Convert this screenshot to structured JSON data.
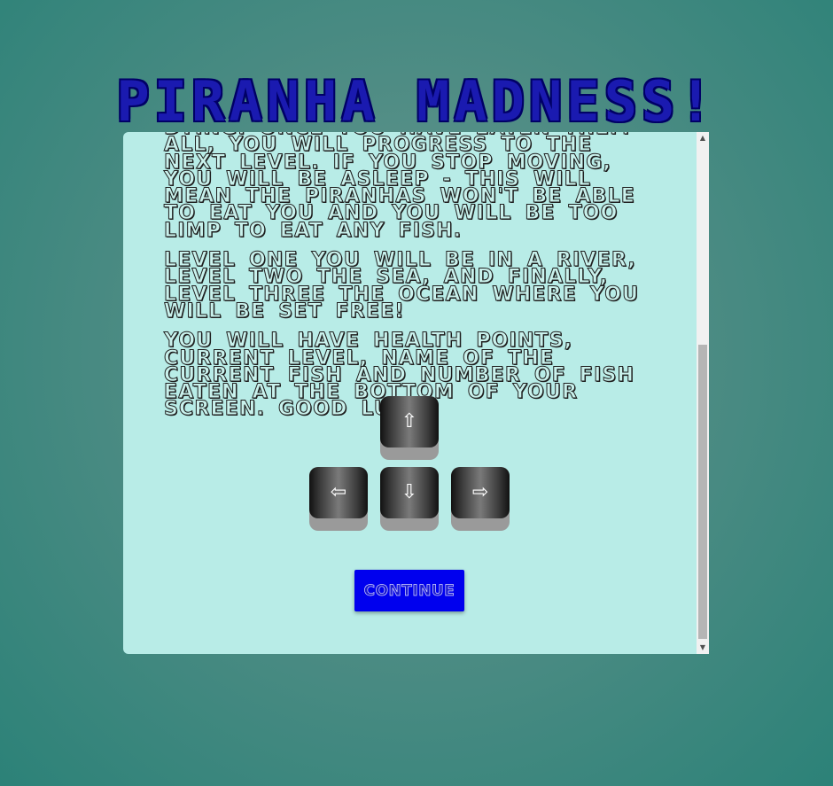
{
  "title": "PIRANHA MADNESS!",
  "instructions": {
    "paragraphs": [
      "DYING. ONCE YOU HAVE EATEN THEM ALL, YOU WILL PROGRESS TO THE NEXT LEVEL. IF YOU STOP MOVING, YOU WILL BE ASLEEP - THIS WILL MEAN THE PIRANHAS WON'T BE ABLE TO EAT YOU AND YOU WILL BE TOO LIMP TO EAT ANY FISH.",
      "LEVEL ONE YOU WILL BE IN A RIVER, LEVEL TWO THE SEA, AND FINALLY, LEVEL THREE THE OCEAN WHERE YOU WILL BE SET FREE!",
      "YOU WILL HAVE HEALTH POINTS, CURRENT LEVEL, NAME OF THE CURRENT FISH AND NUMBER OF FISH EATEN AT THE BOTTOM OF YOUR SCREEN. GOOD LUCK!"
    ]
  },
  "keys": {
    "up": "⇧",
    "left": "⇦",
    "down": "⇩",
    "right": "⇨"
  },
  "continue_label": "CONTINUE",
  "scrollbar": {
    "up_arrow": "▲",
    "down_arrow": "▼"
  },
  "colors": {
    "panel": "#b8ece7",
    "title": "#1a1ab0",
    "button": "#0000ee"
  }
}
